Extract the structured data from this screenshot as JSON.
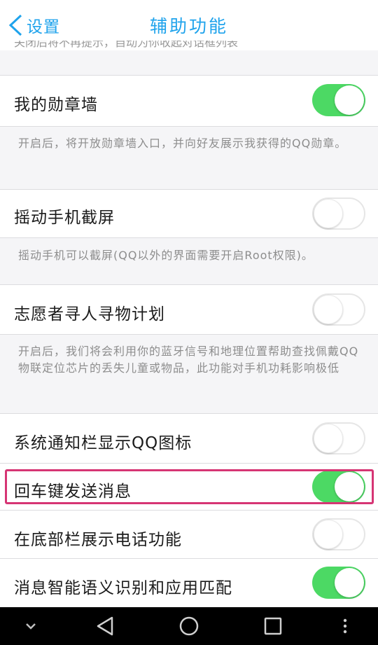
{
  "header": {
    "back_label": "设置",
    "title": "辅助功能"
  },
  "prev_desc_partial": "关闭后将不再提示，自动为你收起对话框列表",
  "settings": [
    {
      "label": "我的勋章墙",
      "on": true,
      "desc": "开启后，将开放勋章墙入口，并向好友展示我获得的QQ勋章。"
    },
    {
      "label": "摇动手机截屏",
      "on": false,
      "desc": "摇动手机可以截屏(QQ以外的界面需要开启Root权限)。"
    },
    {
      "label": "志愿者寻人寻物计划",
      "on": false,
      "desc": "开启后，我们将会利用你的蓝牙信号和地理位置帮助查找佩戴QQ物联定位芯片的丢失儿童或物品，此功能对手机功耗影响极低"
    },
    {
      "label": "系统通知栏显示QQ图标",
      "on": false
    },
    {
      "label": "回车键发送消息",
      "on": true
    },
    {
      "label": "在底部栏展示电话功能",
      "on": false
    },
    {
      "label": "消息智能语义识别和应用匹配",
      "on": true
    }
  ],
  "colors": {
    "accent": "#1fa3ec",
    "toggle_on": "#4cd964",
    "highlight": "#d63574"
  },
  "navbar": {
    "icons": [
      "chevron-down-icon",
      "back-triangle-icon",
      "home-circle-icon",
      "recents-square-icon",
      "more-dots-icon"
    ]
  }
}
